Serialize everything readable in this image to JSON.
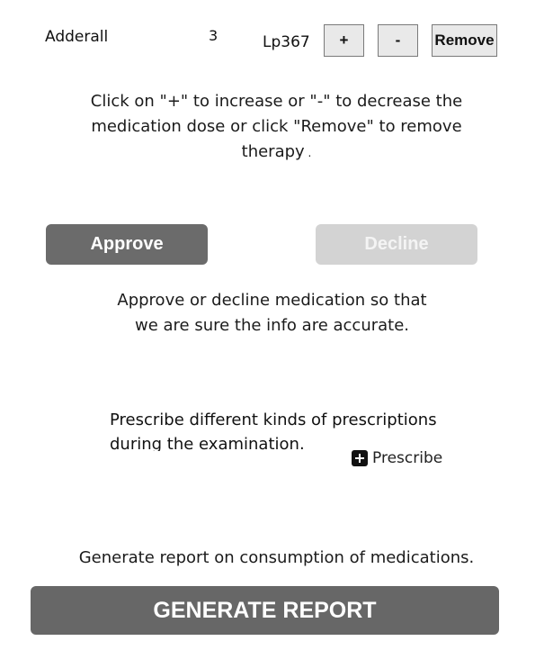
{
  "medication": {
    "name": "Adderall",
    "dose": "3",
    "code": "Lp367",
    "increase_label": "+",
    "decrease_label": "-",
    "remove_label": "Remove"
  },
  "dose_instructions": {
    "line1": "Click on \"+\" to increase or \"-\" to decrease the",
    "line2": "medication dose or click \"Remove\" to remove",
    "line3": "therapy"
  },
  "approval": {
    "approve_label": "Approve",
    "decline_label": "Decline",
    "line1": "Approve or decline medication so that",
    "line2": "we are sure the info are accurate."
  },
  "prescription": {
    "line1": "Prescribe different kinds of prescriptions",
    "line2": "during the examination.",
    "button_label": "Prescribe",
    "button_icon": "plus-square-icon"
  },
  "report": {
    "instruction": "Generate report on consumption of medications.",
    "button_label": "GENERATE REPORT"
  },
  "colors": {
    "approve_bg": "#6b6b6b",
    "decline_bg": "#d3d3d3",
    "generate_bg": "#676767",
    "small_button_bg": "#e9e9e9"
  }
}
